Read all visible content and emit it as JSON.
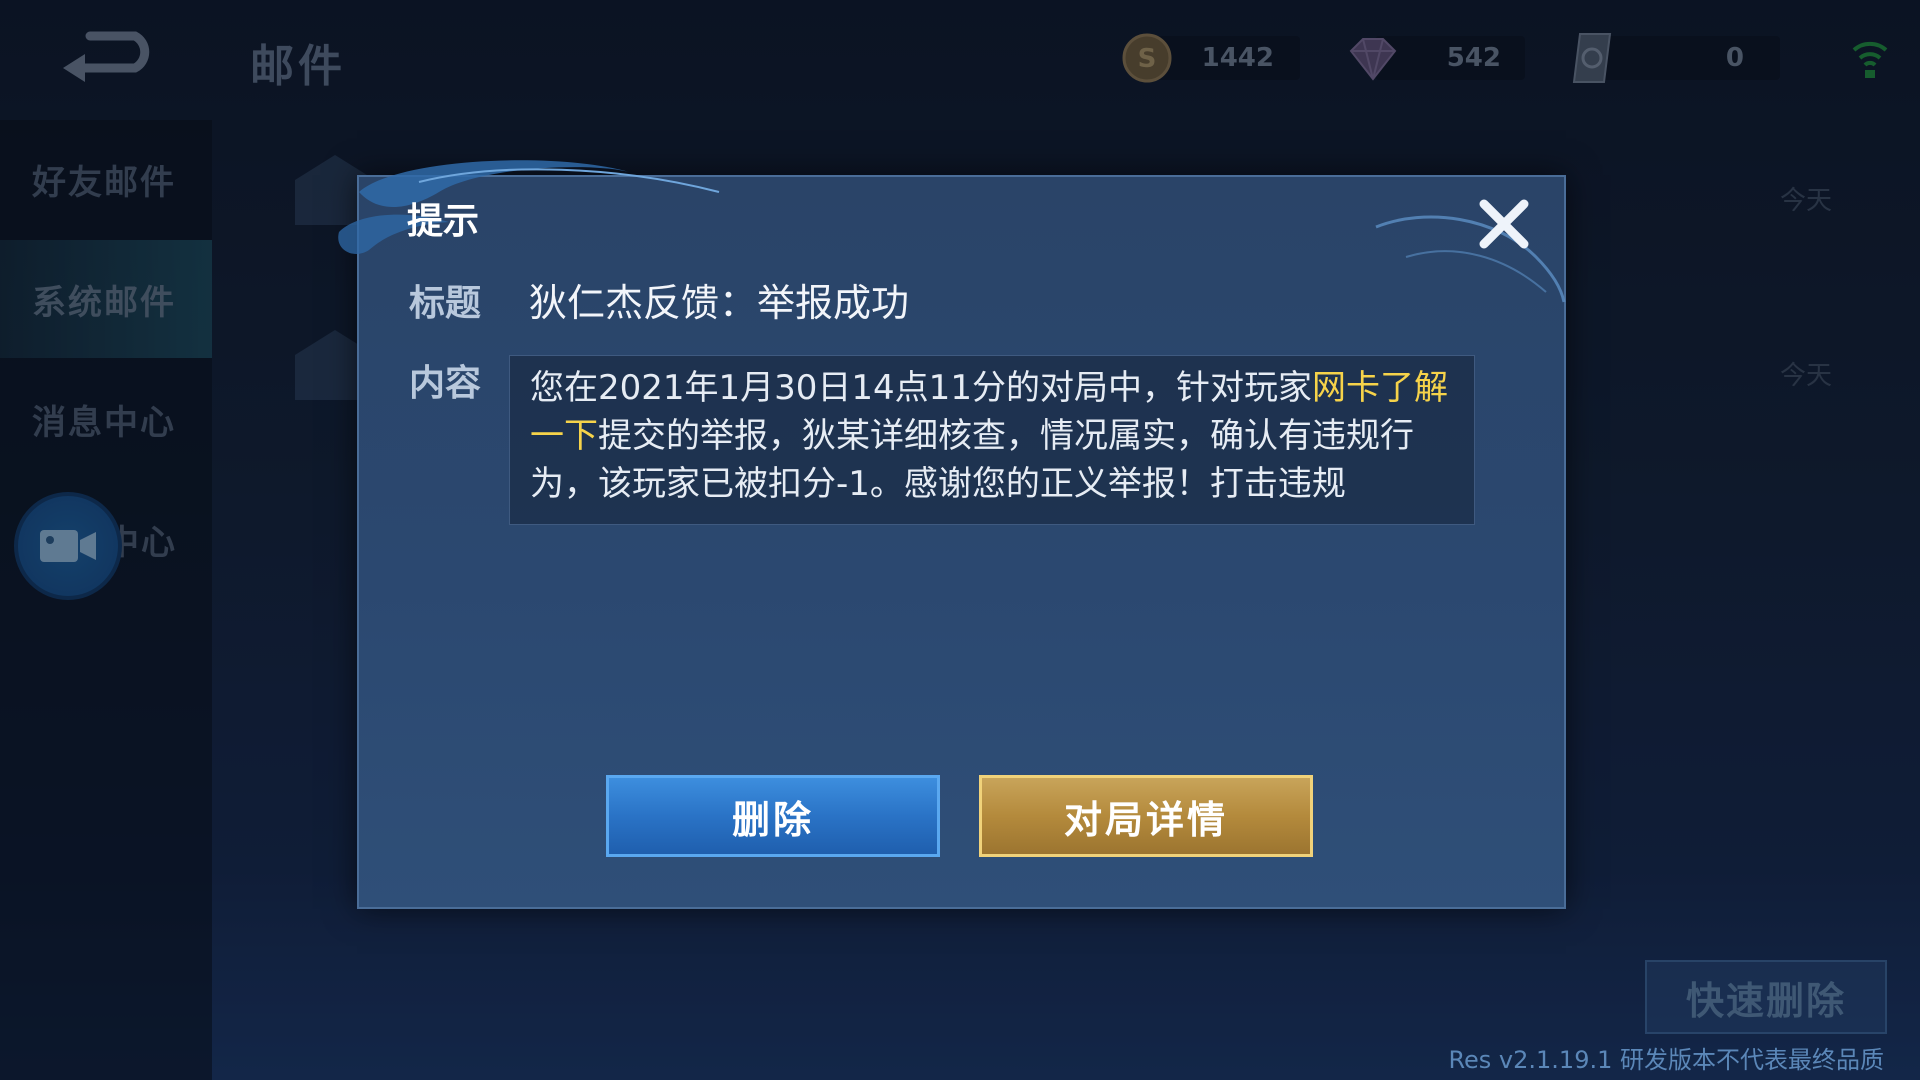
{
  "header": {
    "title": "邮件",
    "back_icon": "back-arrow-icon",
    "resources": [
      {
        "icon": "gold-coin-icon",
        "value": "1442"
      },
      {
        "icon": "gem-icon",
        "value": "542"
      },
      {
        "icon": "ticket-card-icon",
        "value": "0"
      }
    ],
    "signal_icon": "wifi-signal-icon"
  },
  "sidebar": {
    "items": [
      {
        "label": "好友邮件",
        "active": false
      },
      {
        "label": "系统邮件",
        "active": true
      },
      {
        "label": "消息中心",
        "active": false
      },
      {
        "label": "中心",
        "active": false
      }
    ],
    "record_icon": "video-camera-icon"
  },
  "mail_list": {
    "dates": [
      "今天",
      "今天"
    ]
  },
  "footer": {
    "quick_delete_label": "快速删除",
    "version_text": "Res v2.1.19.1 研发版本不代表最终品质"
  },
  "dialog": {
    "title": "提示",
    "subject_label": "标题",
    "subject": "狄仁杰反馈：举报成功",
    "content_label": "内容",
    "content_part1": "您在2021年1月30日14点11分的对局中，针对玩家",
    "content_highlight": "网卡了解一下",
    "content_part2": "提交的举报，狄某详细核查，情况属实，确认有违规行为，该玩家已被扣分-1。感谢您的正义举报！打击违规",
    "delete_label": "删除",
    "detail_label": "对局详情",
    "colors": {
      "highlight": "#f6d34a",
      "delete_button": "#2a73c6",
      "detail_button": "#b48a3c"
    }
  }
}
